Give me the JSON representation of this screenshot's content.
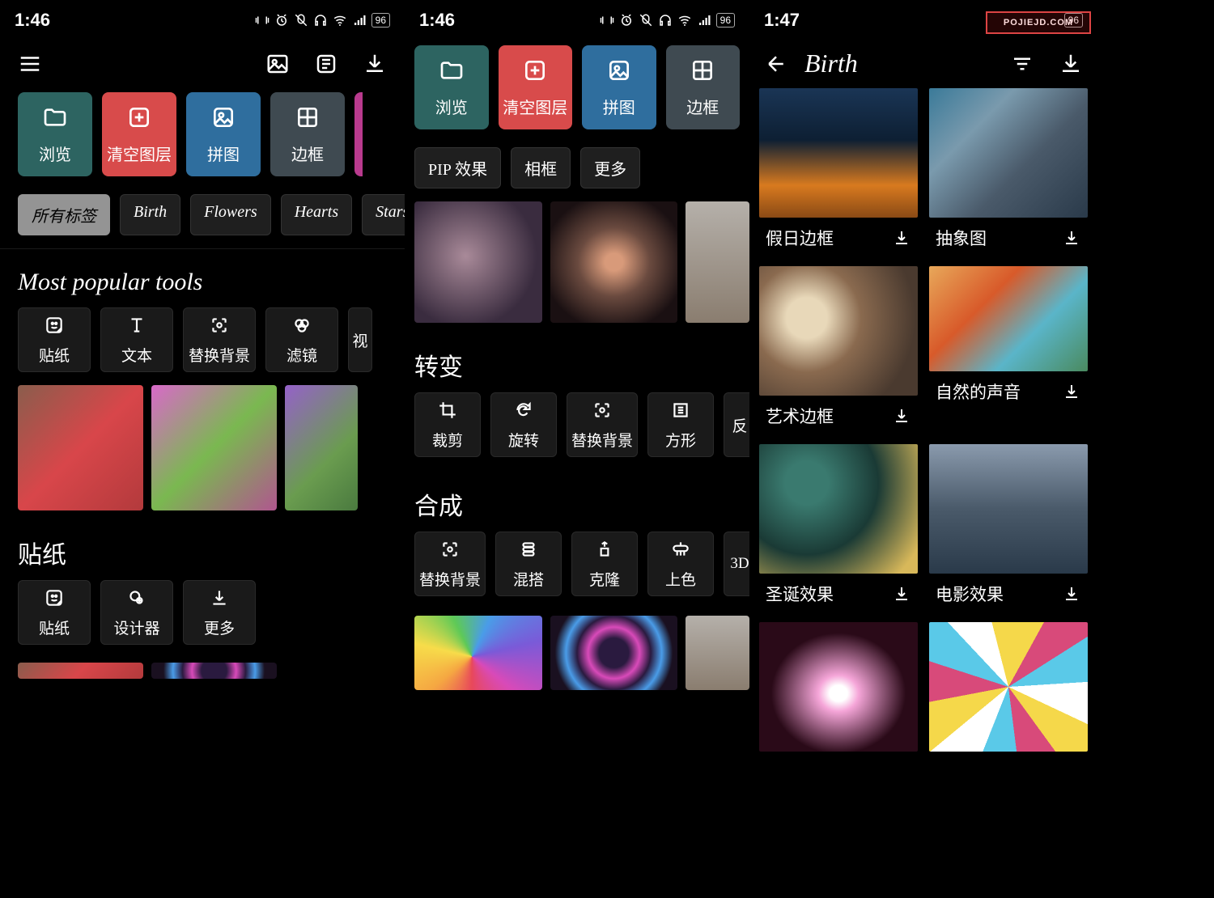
{
  "status": {
    "time_left": "1:46",
    "time_mid": "1:46",
    "time_right": "1:47",
    "battery": "96"
  },
  "screen1": {
    "categories": [
      {
        "label": "浏览",
        "color": "teal"
      },
      {
        "label": "清空图层",
        "color": "red"
      },
      {
        "label": "拼图",
        "color": "blue"
      },
      {
        "label": "边框",
        "color": "gray-bg"
      }
    ],
    "chips": [
      "所有标签",
      "Birth",
      "Flowers",
      "Hearts",
      "Stars"
    ],
    "section_tools": "Most popular tools",
    "tools": [
      "贴纸",
      "文本",
      "替换背景",
      "滤镜",
      "视"
    ],
    "section_stickers": "贴纸",
    "sticker_tools": [
      "贴纸",
      "设计器",
      "更多"
    ]
  },
  "screen2": {
    "categories": [
      {
        "label": "浏览",
        "color": "teal"
      },
      {
        "label": "清空图层",
        "color": "red"
      },
      {
        "label": "拼图",
        "color": "blue"
      },
      {
        "label": "边框",
        "color": "gray-bg"
      }
    ],
    "chips": [
      "PIP 效果",
      "相框",
      "更多"
    ],
    "section_transform": "转变",
    "transform_tools": [
      "裁剪",
      "旋转",
      "替换背景",
      "方形",
      "反"
    ],
    "section_compose": "合成",
    "compose_tools": [
      "替换背景",
      "混搭",
      "克隆",
      "上色",
      "3D"
    ]
  },
  "screen3": {
    "title": "Birth",
    "items": [
      {
        "label": "假日边框"
      },
      {
        "label": "抽象图"
      },
      {
        "label": "艺术边框"
      },
      {
        "label": "自然的声音"
      },
      {
        "label": "圣诞效果"
      },
      {
        "label": "电影效果"
      }
    ]
  },
  "watermark": "POJIEJD.COM"
}
